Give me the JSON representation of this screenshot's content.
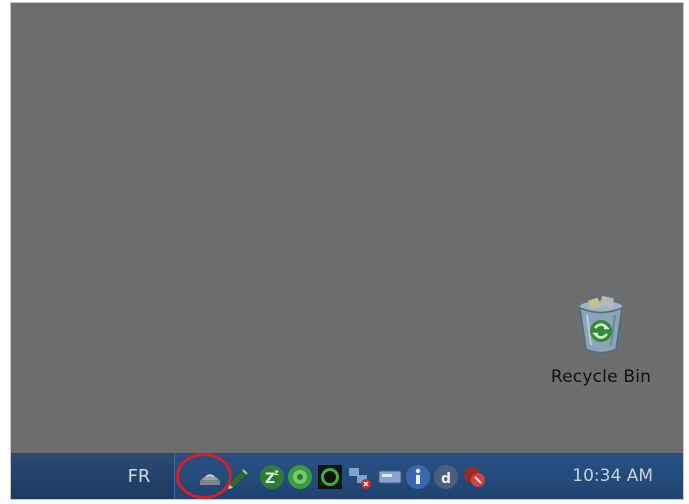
{
  "desktop": {
    "recycle_bin_label": "Recycle Bin"
  },
  "taskbar": {
    "language": "FR",
    "clock": "10:34 AM",
    "tray_icons": [
      "network-tray-icon",
      "pen-tray-icon",
      "zz-sleep-tray-icon",
      "green-circle-tray-icon",
      "black-o-tray-icon",
      "network-disconnected-tray-icon",
      "card-tray-icon",
      "info-tray-icon",
      "d-app-tray-icon",
      "red-shield-tray-icon"
    ]
  },
  "colors": {
    "desktop_background": "#6c6d6f",
    "taskbar": "#22406a",
    "highlight_circle": "#d4202a"
  }
}
